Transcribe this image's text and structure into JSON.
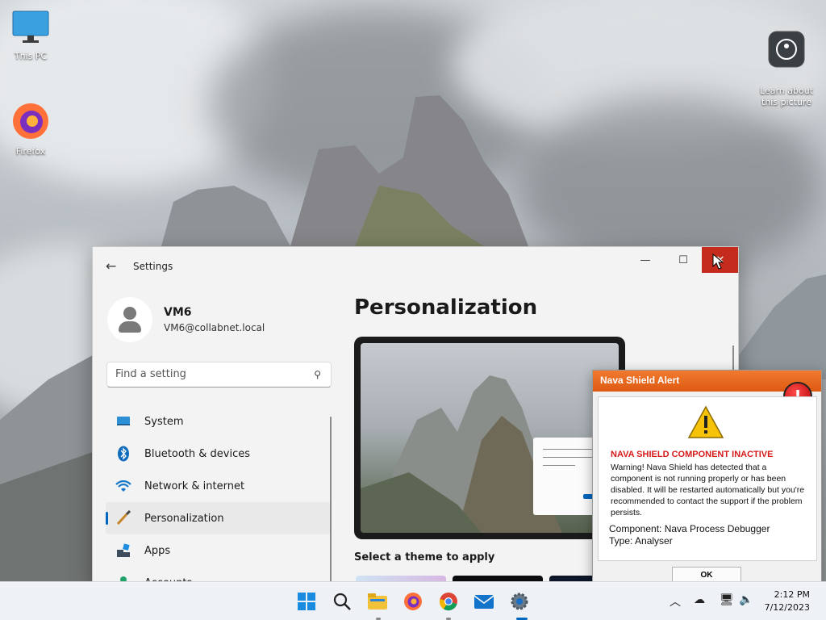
{
  "desktop": {
    "icons": [
      {
        "label": "This PC",
        "icon": "monitor-icon"
      },
      {
        "label": "Firefox",
        "icon": "firefox-icon"
      },
      {
        "label": "Learn about\nthis picture",
        "icon": "camera-info-icon"
      }
    ]
  },
  "settings": {
    "window_title": "Settings",
    "profile": {
      "name": "VM6",
      "email": "VM6@collabnet.local"
    },
    "search_placeholder": "Find a setting",
    "nav": [
      {
        "label": "System",
        "icon": "display-icon"
      },
      {
        "label": "Bluetooth & devices",
        "icon": "bluetooth-icon"
      },
      {
        "label": "Network & internet",
        "icon": "wifi-icon"
      },
      {
        "label": "Personalization",
        "icon": "brush-icon",
        "active": true
      },
      {
        "label": "Apps",
        "icon": "apps-icon"
      },
      {
        "label": "Accounts",
        "icon": "account-icon"
      }
    ],
    "page_title": "Personalization",
    "themes_label": "Select a theme to apply"
  },
  "alert": {
    "title": "Nava Shield Alert",
    "heading": "NAVA SHIELD COMPONENT INACTIVE",
    "message": "Warning! Nava Shield has detected that a component is not running properly or has been disabled. It will be restarted automatically but you're recommended to contact the support if the problem persists.",
    "component": "Component: Nava Process Debugger",
    "type": "Type: Analyser",
    "ok_label": "OK"
  },
  "taskbar": {
    "apps": [
      "start-icon",
      "search-icon",
      "file-explorer-icon",
      "firefox-icon",
      "chrome-icon",
      "mail-icon",
      "settings-gear-icon"
    ],
    "time": "2:12 PM",
    "date": "7/12/2023"
  },
  "colors": {
    "accent": "#0067c0",
    "close": "#c42b1c",
    "alert_orange": "#e8651f",
    "alert_red": "#d61a1a"
  }
}
